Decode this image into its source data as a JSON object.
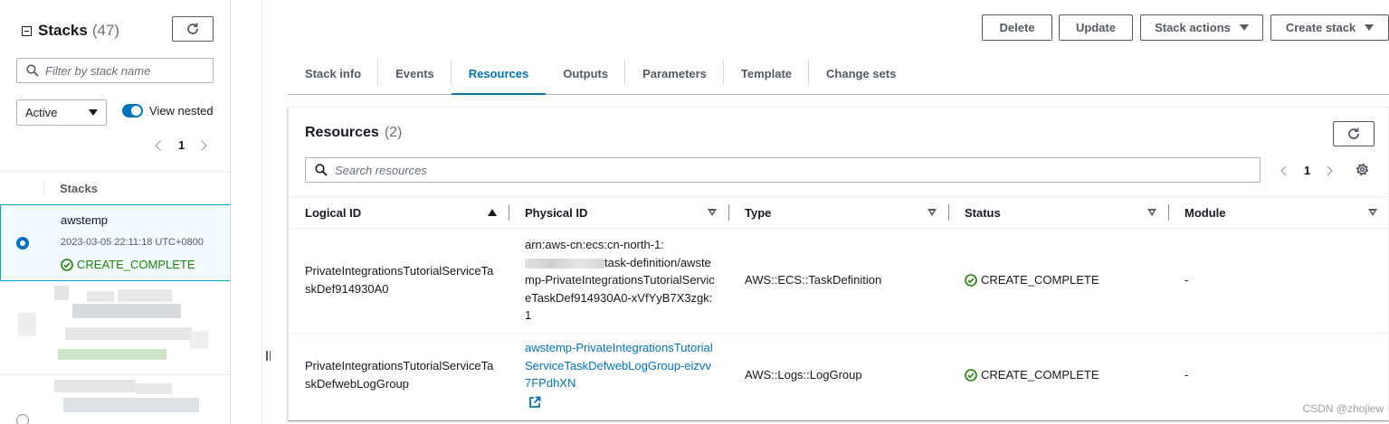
{
  "left_panel": {
    "title": "Stacks",
    "count": "(47)",
    "filter_placeholder": "Filter by stack name",
    "status_filter": "Active",
    "view_nested_label": "View nested",
    "page": "1",
    "column_header": "Stacks",
    "selected_stack": {
      "name": "awstemp",
      "created": "2023-03-05 22:11:18 UTC+0800",
      "status": "CREATE_COMPLETE"
    }
  },
  "actions": {
    "delete": "Delete",
    "update": "Update",
    "stack_actions": "Stack actions",
    "create_stack": "Create stack"
  },
  "tabs": [
    {
      "label": "Stack info",
      "active": false
    },
    {
      "label": "Events",
      "active": false
    },
    {
      "label": "Resources",
      "active": true
    },
    {
      "label": "Outputs",
      "active": false
    },
    {
      "label": "Parameters",
      "active": false
    },
    {
      "label": "Template",
      "active": false
    },
    {
      "label": "Change sets",
      "active": false
    }
  ],
  "resources": {
    "title": "Resources",
    "count": "(2)",
    "search_placeholder": "Search resources",
    "page": "1",
    "columns": [
      "Logical ID",
      "Physical ID",
      "Type",
      "Status",
      "Module"
    ],
    "rows": [
      {
        "logical_id": "PrivateIntegrationsTutorialServiceTaskDef914930A0",
        "physical_id_prefix": "arn:aws-cn:ecs:cn-north-1:",
        "physical_id_suffix": "task-definition/awstemp-PrivateIntegrationsTutorialServiceTaskDef914930A0-xVfYyB7X3zgk:1",
        "type": "AWS::ECS::TaskDefinition",
        "status": "CREATE_COMPLETE",
        "module": "-"
      },
      {
        "logical_id": "PrivateIntegrationsTutorialServiceTaskDefwebLogGroup",
        "physical_id": "awstemp-PrivateIntegrationsTutorialServiceTaskDefwebLogGroup-eizvv7FPdhXN",
        "type": "AWS::Logs::LogGroup",
        "status": "CREATE_COMPLETE",
        "module": "-"
      }
    ]
  },
  "watermark": "CSDN @zhojiew",
  "colors": {
    "accent": "#0073bb",
    "success": "#1d8102",
    "border": "#aab7b8"
  }
}
